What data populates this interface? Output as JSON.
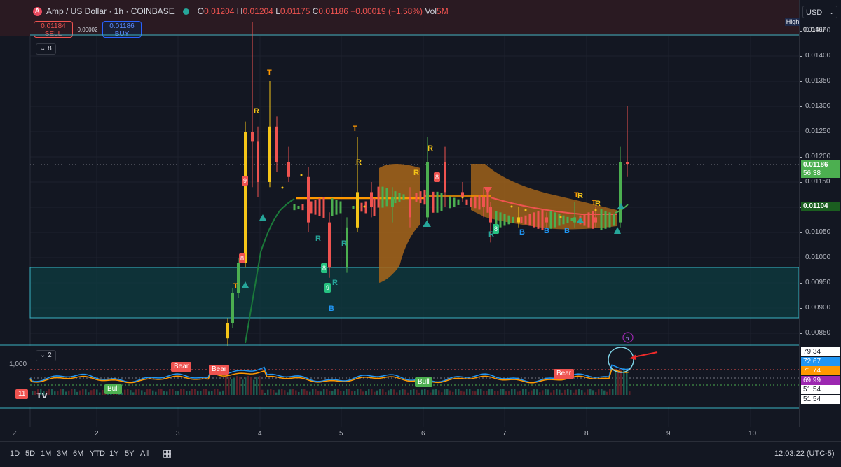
{
  "header": {
    "symbol": "Amp / US Dollar · 1h · COINBASE",
    "ohlc": [
      {
        "k": "O",
        "v": "0.01204"
      },
      {
        "k": "H",
        "v": "0.01204"
      },
      {
        "k": "L",
        "v": "0.01175"
      },
      {
        "k": "C",
        "v": "0.01186"
      },
      {
        "k": "",
        "v": "−0.00019 (−1.58%)"
      }
    ],
    "vol_label": "Vol",
    "vol_value": "5M",
    "sell_price": "0.01184",
    "sell_label": "SELL",
    "spread": "0.00002",
    "buy_price": "0.01186",
    "buy_label": "BUY",
    "currency": "USD"
  },
  "panes": {
    "main_indicators_count": "8",
    "sub_indicators_count": "2"
  },
  "price_axis": {
    "ticks": [
      "0.01450",
      "0.01400",
      "0.01350",
      "0.01300",
      "0.01250",
      "0.01200",
      "0.01150",
      "0.01100",
      "0.01050",
      "0.01000",
      "0.00950",
      "0.00900",
      "0.00850"
    ],
    "high_label": "High",
    "high_value": "0.01467",
    "current_price": "0.01186",
    "countdown": "56:38",
    "ma_value": "0.01104"
  },
  "osc_axis": {
    "left_label": "1,000",
    "values": [
      "79.34",
      "72.67",
      "71.74",
      "69.99",
      "51.54",
      "51.54"
    ],
    "colors": [
      "#ffffff",
      "#2196f3",
      "#ff9800",
      "#9c27b0",
      "#ffffff",
      "#ffffff"
    ]
  },
  "signals": {
    "T": "T",
    "R": "R",
    "B": "B",
    "nine": "9",
    "eight": "8",
    "bear": "Bear",
    "bull": "Bull",
    "eleven": "11"
  },
  "time_axis": [
    "2",
    "3",
    "4",
    "5",
    "6",
    "7",
    "8",
    "9",
    "10"
  ],
  "timeframes": [
    "1D",
    "5D",
    "1M",
    "3M",
    "6M",
    "YTD",
    "1Y",
    "5Y",
    "All"
  ],
  "clock": "12:03:22 (UTC-5)",
  "axis_corner": "Z",
  "colors": {
    "up": "#26a69a",
    "down": "#ef5350",
    "bull_candle": "#4caf50",
    "yellow": "#f5c518",
    "orange": "#ff9800",
    "cyan_zone": "#0e3a3f"
  },
  "chart_data": {
    "type": "candlestick",
    "title": "Amp / US Dollar · 1h · COINBASE",
    "x_ticks": [
      "2",
      "3",
      "4",
      "5",
      "6",
      "7",
      "8",
      "9",
      "10"
    ],
    "ylim": [
      0.0082,
      0.0148
    ],
    "candles": [
      {
        "o": 0.0084,
        "h": 0.0088,
        "l": 0.0082,
        "c": 0.0087
      },
      {
        "o": 0.0087,
        "h": 0.0094,
        "l": 0.0086,
        "c": 0.0093
      },
      {
        "o": 0.0093,
        "h": 0.01,
        "l": 0.0092,
        "c": 0.0099
      },
      {
        "o": 0.0099,
        "h": 0.0127,
        "l": 0.0098,
        "c": 0.0125
      },
      {
        "o": 0.0125,
        "h": 0.01467,
        "l": 0.0114,
        "c": 0.0123
      },
      {
        "o": 0.0123,
        "h": 0.0126,
        "l": 0.0112,
        "c": 0.0115
      },
      {
        "o": 0.0115,
        "h": 0.0135,
        "l": 0.0114,
        "c": 0.0126
      },
      {
        "o": 0.0126,
        "h": 0.0128,
        "l": 0.0117,
        "c": 0.0119
      },
      {
        "o": 0.0119,
        "h": 0.0122,
        "l": 0.0115,
        "c": 0.0116
      },
      {
        "o": 0.0116,
        "h": 0.0118,
        "l": 0.0105,
        "c": 0.0107
      },
      {
        "o": 0.0107,
        "h": 0.0109,
        "l": 0.0096,
        "c": 0.0098
      },
      {
        "o": 0.0098,
        "h": 0.0108,
        "l": 0.0097,
        "c": 0.0106
      },
      {
        "o": 0.0106,
        "h": 0.0124,
        "l": 0.0105,
        "c": 0.0113
      },
      {
        "o": 0.0113,
        "h": 0.0115,
        "l": 0.0108,
        "c": 0.011
      },
      {
        "o": 0.011,
        "h": 0.0114,
        "l": 0.0107,
        "c": 0.0112
      },
      {
        "o": 0.0112,
        "h": 0.0114,
        "l": 0.0106,
        "c": 0.0108
      },
      {
        "o": 0.0108,
        "h": 0.0124,
        "l": 0.0107,
        "c": 0.0119
      },
      {
        "o": 0.0119,
        "h": 0.0122,
        "l": 0.011,
        "c": 0.0113
      },
      {
        "o": 0.0113,
        "h": 0.0115,
        "l": 0.0111,
        "c": 0.0112
      },
      {
        "o": 0.0112,
        "h": 0.0114,
        "l": 0.0108,
        "c": 0.011
      },
      {
        "o": 0.011,
        "h": 0.0111,
        "l": 0.0103,
        "c": 0.0107
      },
      {
        "o": 0.0107,
        "h": 0.011,
        "l": 0.0106,
        "c": 0.0108
      },
      {
        "o": 0.0108,
        "h": 0.0109,
        "l": 0.0106,
        "c": 0.0107
      },
      {
        "o": 0.0107,
        "h": 0.0111,
        "l": 0.0106,
        "c": 0.0108
      },
      {
        "o": 0.0108,
        "h": 0.011,
        "l": 0.0106,
        "c": 0.0107
      },
      {
        "o": 0.0107,
        "h": 0.0122,
        "l": 0.0106,
        "c": 0.0119
      },
      {
        "o": 0.0119,
        "h": 0.013,
        "l": 0.0116,
        "c": 0.01186
      }
    ]
  }
}
